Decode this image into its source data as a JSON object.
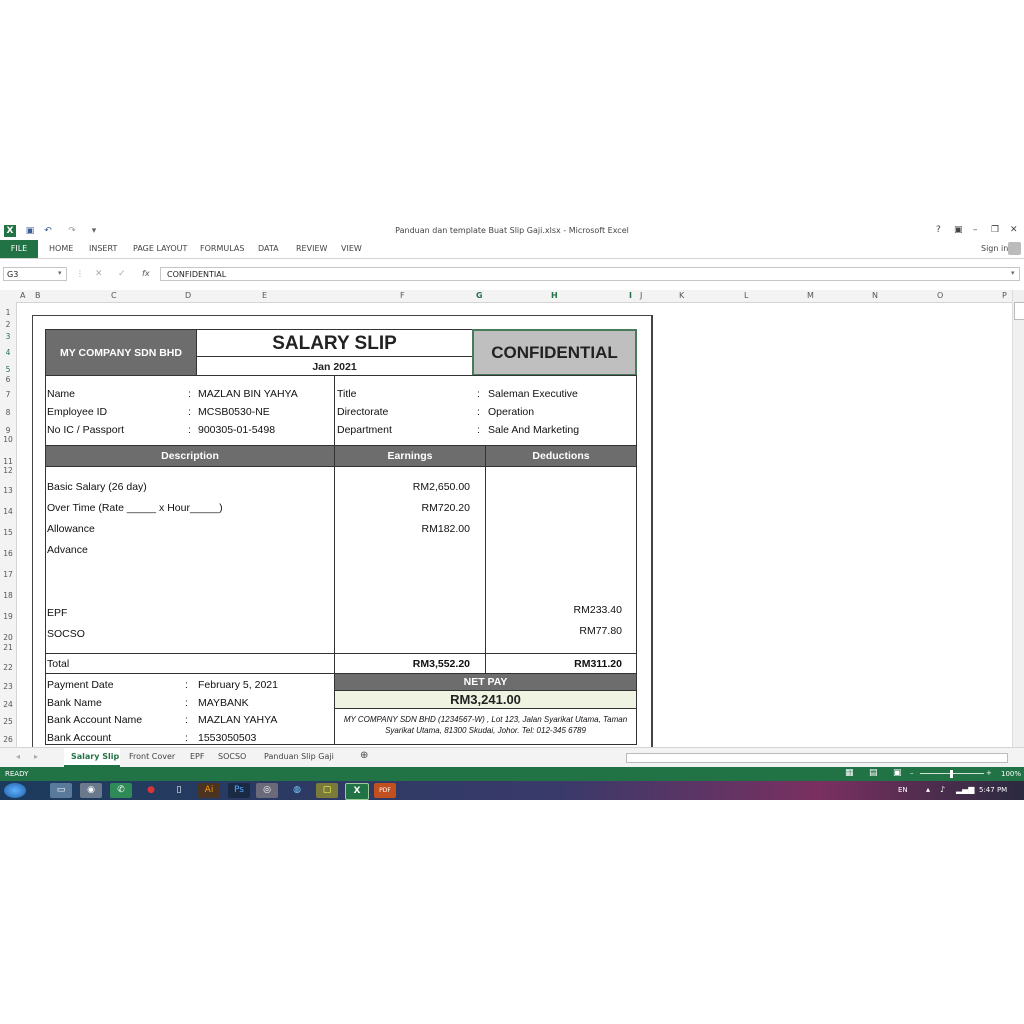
{
  "window": {
    "title": "Panduan dan template Buat Slip Gaji.xlsx - Microsoft Excel",
    "controls": [
      "?",
      "▣",
      "–",
      "❐",
      "✕"
    ]
  },
  "ribbon": {
    "tabs": [
      "FILE",
      "HOME",
      "INSERT",
      "PAGE LAYOUT",
      "FORMULAS",
      "DATA",
      "REVIEW",
      "VIEW"
    ],
    "sign_in": "Sign in"
  },
  "formula_bar": {
    "name_box": "G3",
    "fx": "fx",
    "value": "CONFIDENTIAL"
  },
  "columns": [
    "A",
    "B",
    "C",
    "D",
    "E",
    "F",
    "G",
    "H",
    "I",
    "J",
    "K",
    "L",
    "M",
    "N",
    "O",
    "P"
  ],
  "rows": [
    "1",
    "2",
    "3",
    "4",
    "5",
    "6",
    "7",
    "8",
    "9",
    "10",
    "11",
    "12",
    "13",
    "14",
    "15",
    "16",
    "17",
    "18",
    "19",
    "20",
    "21",
    "22",
    "23",
    "24",
    "25",
    "26"
  ],
  "slip": {
    "company": "MY COMPANY SDN BHD",
    "heading": "SALARY SLIP",
    "period": "Jan 2021",
    "confidential": "CONFIDENTIAL",
    "employee": [
      {
        "label": "Name",
        "value": "MAZLAN BIN YAHYA"
      },
      {
        "label": "Employee ID",
        "value": "MCSB0530-NE"
      },
      {
        "label": "No IC / Passport",
        "value": "900305-01-5498"
      }
    ],
    "job": [
      {
        "label": "Title",
        "value": "Saleman Executive"
      },
      {
        "label": "Directorate",
        "value": "Operation"
      },
      {
        "label": "Department",
        "value": "Sale And Marketing"
      }
    ],
    "colon": ":",
    "headers": {
      "description": "Description",
      "earnings": "Earnings",
      "deductions": "Deductions"
    },
    "items": [
      {
        "desc": "Basic Salary (26 day)",
        "earn": "RM2,650.00",
        "ded": ""
      },
      {
        "desc": "Over Time (Rate _____ x Hour_____)",
        "earn": "RM720.20",
        "ded": ""
      },
      {
        "desc": "Allowance",
        "earn": "RM182.00",
        "ded": ""
      },
      {
        "desc": "Advance",
        "earn": "",
        "ded": ""
      },
      {
        "desc": "EPF",
        "earn": "",
        "ded": "RM233.40"
      },
      {
        "desc": "SOCSO",
        "earn": "",
        "ded": "RM77.80"
      }
    ],
    "total_label": "Total",
    "total_earnings": "RM3,552.20",
    "total_deductions": "RM311.20",
    "payment": [
      {
        "label": "Payment Date",
        "value": "February 5, 2021"
      },
      {
        "label": "Bank Name",
        "value": "MAYBANK"
      },
      {
        "label": "Bank Account Name",
        "value": "MAZLAN YAHYA"
      },
      {
        "label": "Bank Account",
        "value": "1553050503"
      }
    ],
    "net_pay_label": "NET PAY",
    "net_pay": "RM3,241.00",
    "footer_address_1": "MY COMPANY SDN BHD (1234567-W) , Lot 123, Jalan Syarikat Utama, Taman",
    "footer_address_2": "Syarikat Utama, 81300 Skudai, Johor. Tel: 012-345 6789"
  },
  "sheets": [
    "Salary Slip",
    "Front Cover",
    "EPF",
    "SOCSO",
    "Panduan Slip Gaji"
  ],
  "active_sheet": "Salary Slip",
  "status": {
    "ready": "READY",
    "zoom": "100%"
  },
  "taskbar": {
    "lang": "EN",
    "time": "5:47 PM"
  },
  "colors": {
    "excel_green": "#217346",
    "header_grey": "#6d6d6d",
    "net_pay_bg": "#eef3e2"
  }
}
